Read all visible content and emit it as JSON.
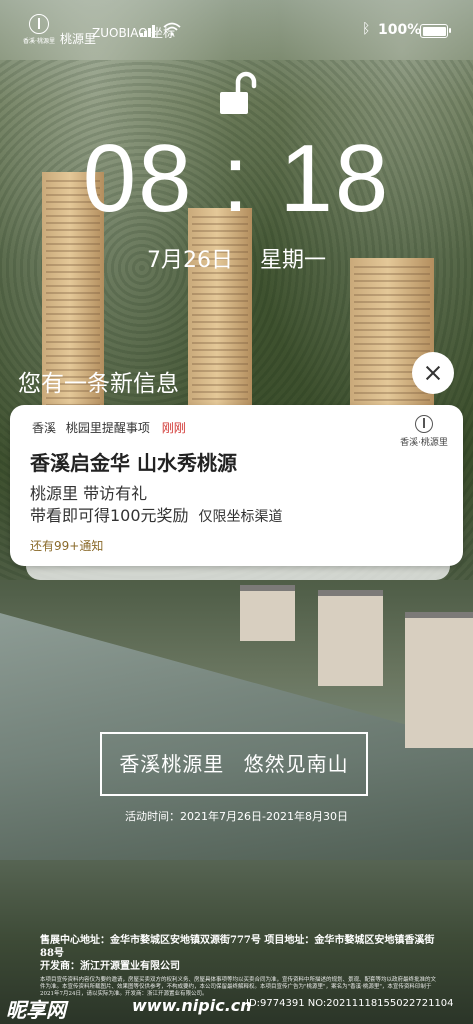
{
  "status_bar": {
    "brand_logo_text": "香溪·桃源里",
    "brand_name": "桃源里",
    "carrier": "ZUOBIAO.坐标",
    "battery": "100%",
    "icons": [
      "signal-icon",
      "wifi-icon",
      "bluetooth-icon",
      "battery-icon"
    ]
  },
  "lock": {
    "icon": "unlocked-padlock-icon",
    "time": "08 : 18",
    "date": "7月26日",
    "weekday": "星期一"
  },
  "notice": {
    "heading": "您有一条新信息",
    "close_icon": "close-icon"
  },
  "card": {
    "source": "香溪",
    "app": "桃园里提醒事项",
    "time_ago": "刚刚",
    "logo_text": "香溪·桃源里",
    "title": "香溪启金华  山水秀桃源",
    "line1": "桃源里  带访有礼",
    "line2": "带看即可得100元奖励",
    "line2_note": "仅限坐标渠道",
    "more": "还有99+通知",
    "accent": "#d0312d"
  },
  "slogan": {
    "part1": "香溪桃源里",
    "part2": "悠然见南山"
  },
  "event": "活动时间：2021年7月26日-2021年8月30日",
  "footer": {
    "address1": "售展中心地址：金华市婺城区安地镇双源街777号  项目地址：金华市婺城区安地镇香溪街88号",
    "developer": "开发商：浙江开源置业有限公司",
    "disclaimer": "本项目宣传资料内容仅为要约邀请，房屋买卖双方的权利义务、房屋具体事项等均以买卖合同为准，宣传资料中所描述的规划、景观、配套等均以政府最终批准的文件为准。本宣传资料所载图片、效果图等仅供参考，不构成要约，本公司保留最终解释权。本项目宣传广告为\"桃源里\"，案名为\"香溪·桃源里\"，本宣传资料印制于2021年7月24日，请以实际为准。开发商：浙江开源置业有限公司。"
  },
  "watermark": {
    "logo": "昵享网",
    "url": "www.nipic.cn",
    "id": "ID:9774391 NO:20211118155022721104"
  }
}
